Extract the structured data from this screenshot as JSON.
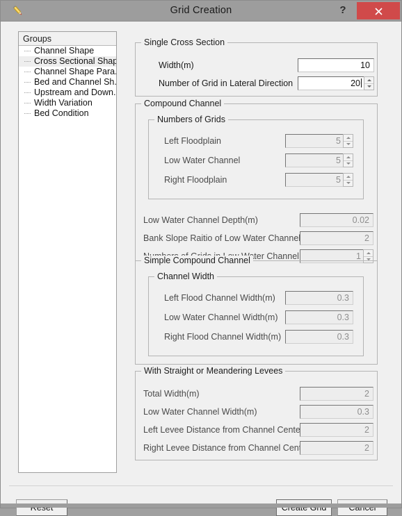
{
  "window": {
    "title": "Grid Creation",
    "icon": "pencil-icon",
    "help_label": "?",
    "close_label": "✕",
    "colors": {
      "titlebar": "#9d9d9d",
      "close_button": "#d04a4a",
      "dialog_background": "#f0f0f0",
      "groupbox_border": "#b4b4b4",
      "disabled_text": "#8e8e8e"
    }
  },
  "sidebar": {
    "header": "Groups",
    "items": [
      {
        "label": "Channel Shape",
        "selected": false
      },
      {
        "label": "Cross Sectional Shap...",
        "selected": true
      },
      {
        "label": "Channel Shape Para...",
        "selected": false
      },
      {
        "label": "Bed and Channel Sh...",
        "selected": false
      },
      {
        "label": "Upstream and Down...",
        "selected": false
      },
      {
        "label": "Width Variation",
        "selected": false
      },
      {
        "label": "Bed Condition",
        "selected": false
      }
    ]
  },
  "groups": {
    "single_cross_section": {
      "title": "Single Cross Section",
      "fields": [
        {
          "label": "Width(m)",
          "value": "10",
          "type": "text",
          "enabled": true
        },
        {
          "label": "Number of Grid in Lateral Direction",
          "value": "20",
          "type": "spinner",
          "enabled": true,
          "caret": true
        }
      ]
    },
    "compound_channel": {
      "title": "Compound Channel",
      "numbers_of_grids": {
        "title": "Numbers of Grids",
        "fields": [
          {
            "label": "Left Floodplain",
            "value": "5",
            "type": "spinner",
            "enabled": false
          },
          {
            "label": "Low Water Channel",
            "value": "5",
            "type": "spinner",
            "enabled": false
          },
          {
            "label": "Right Floodplain",
            "value": "5",
            "type": "spinner",
            "enabled": false
          }
        ]
      },
      "fields": [
        {
          "label": "Low Water Channel Depth(m)",
          "value": "0.02",
          "type": "text",
          "enabled": false
        },
        {
          "label": "Bank Slope Raitio of Low Water Channel",
          "value": "2",
          "type": "text",
          "enabled": false
        },
        {
          "label": "Numbers of Grids in Low Water Channel Bank",
          "value": "1",
          "type": "spinner",
          "enabled": false
        }
      ]
    },
    "simple_compound_channel": {
      "title": "Simple Compound Channel",
      "channel_width": {
        "title": "Channel Width",
        "fields": [
          {
            "label": "Left Flood Channel Width(m)",
            "value": "0.3",
            "type": "text",
            "enabled": false
          },
          {
            "label": "Low Water Channel Width(m)",
            "value": "0.3",
            "type": "text",
            "enabled": false
          },
          {
            "label": "Right Flood Channel Width(m)",
            "value": "0.3",
            "type": "text",
            "enabled": false
          }
        ]
      }
    },
    "levees": {
      "title": "With Straight or Meandering Levees",
      "fields": [
        {
          "label": "Total Width(m)",
          "value": "2",
          "type": "text",
          "enabled": false
        },
        {
          "label": "Low Water Channel Width(m)",
          "value": "0.3",
          "type": "text",
          "enabled": false
        },
        {
          "label": "Left Levee Distance from Channel Center(m)",
          "value": "2",
          "type": "text",
          "enabled": false
        },
        {
          "label": "Right Levee Distance from Channel Center(m)",
          "value": "2",
          "type": "text",
          "enabled": false
        }
      ]
    }
  },
  "footer": {
    "reset": "Reset",
    "create_grid": "Create Grid",
    "cancel": "Cancel"
  }
}
